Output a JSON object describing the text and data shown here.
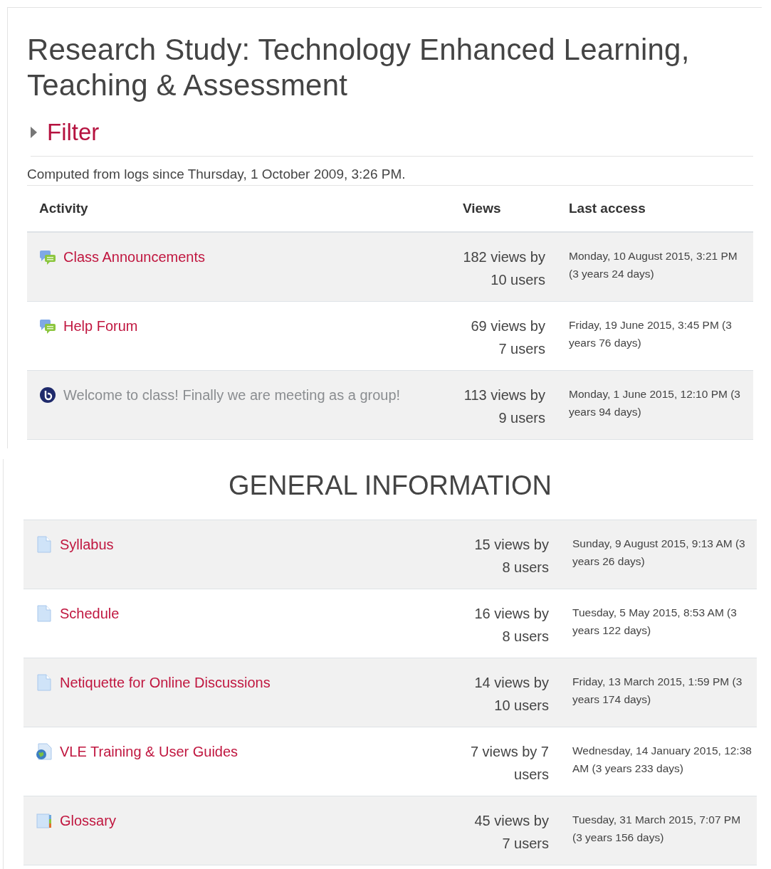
{
  "course_title": "Research Study: Technology Enhanced Learning, Teaching & Assessment",
  "filter": {
    "label": "Filter",
    "expanded": false
  },
  "computed_note": "Computed from logs since Thursday, 1 October 2009, 3:26 PM.",
  "table": {
    "columns": [
      "Activity",
      "Views",
      "Last access"
    ],
    "rows": [
      {
        "kind": "forum",
        "activity": "Class Announcements",
        "dimmed": false,
        "views": "182 views by 10 users",
        "last_access": "Monday, 10 August 2015, 3:21 PM (3 years 24 days)"
      },
      {
        "kind": "forum",
        "activity": "Help Forum",
        "dimmed": false,
        "views": "69 views by 7 users",
        "last_access": "Friday, 19 June 2015, 3:45 PM (3 years 76 days)"
      },
      {
        "kind": "conference",
        "activity": "Welcome to class! Finally we are meeting as a group!",
        "dimmed": true,
        "views": "113 views by 9 users",
        "last_access": "Monday, 1 June 2015, 12:10 PM (3 years 94 days)"
      }
    ]
  },
  "section": {
    "title": "GENERAL INFORMATION",
    "rows": [
      {
        "kind": "page",
        "activity": "Syllabus",
        "dimmed": false,
        "views": "15 views by 8 users",
        "last_access": "Sunday, 9 August 2015, 9:13 AM (3 years 26 days)"
      },
      {
        "kind": "page",
        "activity": "Schedule",
        "dimmed": false,
        "views": "16 views by 8 users",
        "last_access": "Tuesday, 5 May 2015, 8:53 AM (3 years 122 days)"
      },
      {
        "kind": "page",
        "activity": "Netiquette for Online Discussions",
        "dimmed": false,
        "views": "14 views by 10 users",
        "last_access": "Friday, 13 March 2015, 1:59 PM (3 years 174 days)"
      },
      {
        "kind": "url",
        "activity": "VLE Training & User Guides",
        "dimmed": false,
        "views": "7 views by 7 users",
        "last_access": "Wednesday, 14 January 2015, 12:38 AM (3 years 233 days)"
      },
      {
        "kind": "glossary",
        "activity": "Glossary",
        "dimmed": false,
        "views": "45 views by 7 users",
        "last_access": "Tuesday, 31 March 2015, 7:07 PM (3 years 156 days)"
      }
    ]
  }
}
